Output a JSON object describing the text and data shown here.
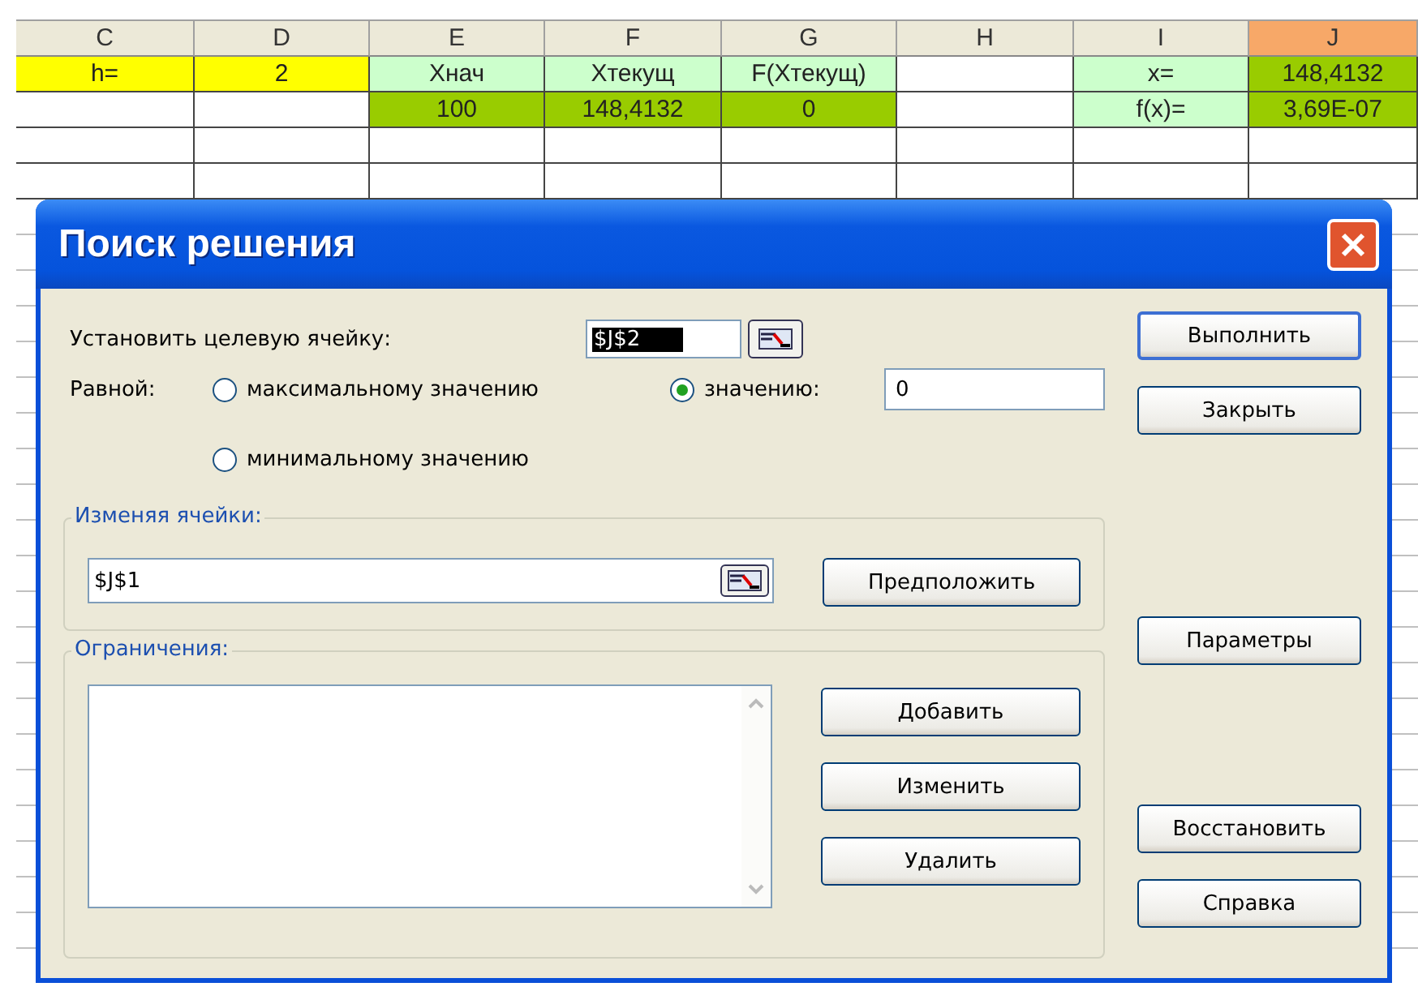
{
  "sheet": {
    "columns": [
      {
        "label": "C",
        "selected": false
      },
      {
        "label": "D",
        "selected": false
      },
      {
        "label": "E",
        "selected": false
      },
      {
        "label": "F",
        "selected": false
      },
      {
        "label": "G",
        "selected": false
      },
      {
        "label": "H",
        "selected": false
      },
      {
        "label": "I",
        "selected": false
      },
      {
        "label": "J",
        "selected": true
      }
    ],
    "rows": [
      [
        {
          "text": "h=",
          "color": "#ffff00"
        },
        {
          "text": "2",
          "color": "#ffff00"
        },
        {
          "text": "Хнач",
          "color": "#ccffcc"
        },
        {
          "text": "Xтекущ",
          "color": "#ccffcc"
        },
        {
          "text": "F(Xтекущ)",
          "color": "#ccffcc"
        },
        {
          "text": "",
          "color": "#ffffff"
        },
        {
          "text": "x=",
          "color": "#ccffcc"
        },
        {
          "text": "148,4132",
          "color": "#99cc00"
        }
      ],
      [
        {
          "text": "",
          "color": "#ffffff"
        },
        {
          "text": "",
          "color": "#ffffff"
        },
        {
          "text": "100",
          "color": "#99cc00"
        },
        {
          "text": "148,4132",
          "color": "#99cc00"
        },
        {
          "text": "0",
          "color": "#99cc00"
        },
        {
          "text": "",
          "color": "#ffffff"
        },
        {
          "text": "f(x)=",
          "color": "#ccffcc"
        },
        {
          "text": "3,69E-07",
          "color": "#99cc00"
        }
      ]
    ]
  },
  "dialog": {
    "title": "Поиск решения",
    "target_label": "Установить целевую ячейку:",
    "target_value": "$J$2",
    "equal_label": "Равной:",
    "options": [
      {
        "label": "максимальному значению",
        "selected": false
      },
      {
        "label": "значению:",
        "selected": true
      },
      {
        "label": "минимальному значению",
        "selected": false
      }
    ],
    "value_field": "0",
    "changing_label": "Изменяя ячейки:",
    "changing_value": "$J$1",
    "guess_button": "Предположить",
    "constraints_label": "Ограничения:",
    "constraint_buttons": [
      "Добавить",
      "Изменить",
      "Удалить"
    ],
    "side_buttons": [
      {
        "label": "Выполнить",
        "kind": "default"
      },
      {
        "label": "Закрыть",
        "kind": "top"
      },
      {
        "label": "Параметры",
        "kind": "middle"
      },
      {
        "label": "Восстановить",
        "kind": "bottom"
      },
      {
        "label": "Справка",
        "kind": "bottom"
      }
    ]
  }
}
